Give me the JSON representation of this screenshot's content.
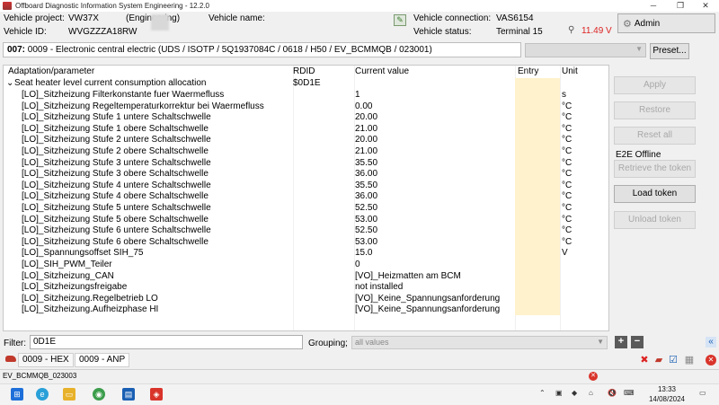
{
  "window": {
    "title": "Offboard Diagnostic Information System Engineering - 12.2.0",
    "minimize": "─",
    "restore": "❐",
    "close": "✕"
  },
  "header": {
    "vehicle_project_label": "Vehicle project:",
    "vehicle_project_value": "VW37X",
    "mode": "(Engineering)",
    "vehicle_name_label": "Vehicle name:",
    "vehicle_name_value": "",
    "vehicle_id_label": "Vehicle ID:",
    "vehicle_id_value": "WVGZZZA18RW",
    "connection_label": "Vehicle connection:",
    "connection_value": "VAS6154",
    "status_label": "Vehicle status:",
    "status_value": "Terminal 15",
    "voltage": "11.49 V",
    "admin_label": "Admin"
  },
  "path": {
    "prefix": "007:",
    "text": " 0009 - Electronic central electric  (UDS / ISOTP / 5Q1937084C / 0618 / H50 / EV_BCMMQB / 023001)",
    "preset_label": "Preset..."
  },
  "table": {
    "headers": [
      "Adaptation/parameter",
      "RDID",
      "Current value",
      "Entry",
      "Unit"
    ],
    "group": {
      "label": "Seat heater level current consumption allocation",
      "rdid": "$0D1E"
    },
    "rows": [
      {
        "param": "[LO]_Sitzheizung Filterkonstante fuer Waermefluss",
        "value": "1",
        "unit": "s"
      },
      {
        "param": "[LO]_Sitzheizung Regeltemperaturkorrektur bei Waermefluss",
        "value": "0.00",
        "unit": "°C"
      },
      {
        "param": "[LO]_Sitzheizung Stufe 1 untere Schaltschwelle",
        "value": "20.00",
        "unit": "°C"
      },
      {
        "param": "[LO]_Sitzheizung Stufe 1 obere Schaltschwelle",
        "value": "21.00",
        "unit": "°C"
      },
      {
        "param": "[LO]_Sitzheizung Stufe 2 untere Schaltschwelle",
        "value": "20.00",
        "unit": "°C"
      },
      {
        "param": "[LO]_Sitzheizung Stufe 2 obere Schaltschwelle",
        "value": "21.00",
        "unit": "°C"
      },
      {
        "param": "[LO]_Sitzheizung Stufe 3 untere Schaltschwelle",
        "value": "35.50",
        "unit": "°C"
      },
      {
        "param": "[LO]_Sitzheizung Stufe 3 obere Schaltschwelle",
        "value": "36.00",
        "unit": "°C"
      },
      {
        "param": "[LO]_Sitzheizung Stufe 4 untere Schaltschwelle",
        "value": "35.50",
        "unit": "°C"
      },
      {
        "param": "[LO]_Sitzheizung Stufe 4 obere Schaltschwelle",
        "value": "36.00",
        "unit": "°C"
      },
      {
        "param": "[LO]_Sitzheizung Stufe 5 untere Schaltschwelle",
        "value": "52.50",
        "unit": "°C"
      },
      {
        "param": "[LO]_Sitzheizung Stufe 5 obere Schaltschwelle",
        "value": "53.00",
        "unit": "°C"
      },
      {
        "param": "[LO]_Sitzheizung Stufe 6 untere Schaltschwelle",
        "value": "52.50",
        "unit": "°C"
      },
      {
        "param": "[LO]_Sitzheizung Stufe 6 obere Schaltschwelle",
        "value": "53.00",
        "unit": "°C"
      },
      {
        "param": "[LO]_Spannungsoffset SIH_75",
        "value": "15.0",
        "unit": "V"
      },
      {
        "param": "[LO]_SIH_PWM_Teiler",
        "value": "0",
        "unit": ""
      },
      {
        "param": "[LO]_Sitzheizung_CAN",
        "value": "[VO]_Heizmatten am BCM",
        "unit": ""
      },
      {
        "param": "[LO]_Sitzheizungsfreigabe",
        "value": "not installed",
        "unit": ""
      },
      {
        "param": "[LO]_Sitzheizung.Regelbetrieb LO",
        "value": "[VO]_Keine_Spannungsanforderung",
        "unit": ""
      },
      {
        "param": "[LO]_Sitzheizung.Aufheizphase HI",
        "value": "[VO]_Keine_Spannungsanforderung",
        "unit": ""
      }
    ]
  },
  "side": {
    "apply": "Apply",
    "restore": "Restore",
    "reset_all": "Reset all",
    "e2e_status": "E2E Offline",
    "retrieve_token": "Retrieve the token",
    "load_token": "Load token",
    "unload_token": "Unload token"
  },
  "filter": {
    "label": "Filter:",
    "value": "0D1E",
    "grouping_label": "Grouping;",
    "grouping_value": "all values",
    "plus": "+",
    "minus": "−"
  },
  "tabs": [
    {
      "label": "0009 - HEX"
    },
    {
      "label": "0009 - ANP"
    }
  ],
  "statusbar": {
    "text": "EV_BCMMQB_023003"
  },
  "taskbar": {
    "time": "13:33",
    "date": "14/08/2024"
  }
}
